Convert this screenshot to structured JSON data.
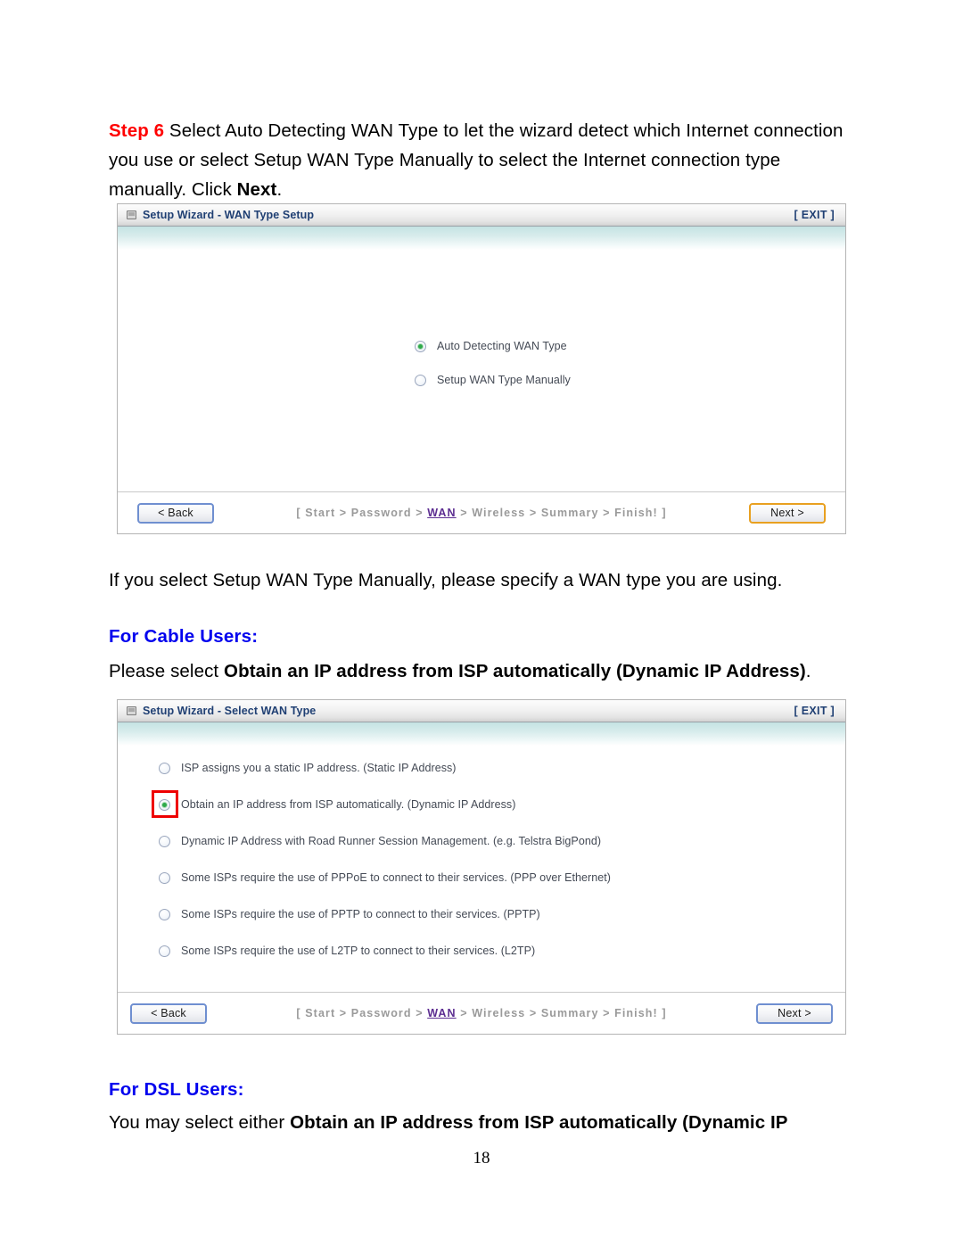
{
  "document": {
    "page_number": "18"
  },
  "step6": {
    "label": "Step 6",
    "text_part1": " Select Auto Detecting WAN Type to let the wizard detect which Internet connection you use or select Setup WAN Type Manually to select the Internet connection type manually. Click ",
    "bold_word": "Next",
    "text_part2": "."
  },
  "intro_paragraph": "If you select Setup WAN Type Manually, please specify a WAN type you are using.",
  "cable_section": {
    "heading": "For Cable Users:",
    "text_prefix": "Please select ",
    "text_bold": "Obtain an IP address from ISP automatically (Dynamic IP Address)",
    "text_suffix": "."
  },
  "dsl_section": {
    "heading": "For DSL Users:",
    "text_prefix": "You may select either ",
    "text_bold": "Obtain an IP address from ISP automatically (Dynamic IP"
  },
  "panel1": {
    "icon": "window-monitor-icon",
    "title": "Setup Wizard - WAN Type Setup",
    "exit_label": "[ EXIT ]",
    "options": [
      {
        "label": "Auto Detecting WAN Type",
        "selected": true
      },
      {
        "label": "Setup WAN Type Manually",
        "selected": false
      }
    ],
    "footer": {
      "back_label": "< Back",
      "next_label": "Next >",
      "next_focus_color": "#e8a020",
      "breadcrumb": {
        "open": "[ ",
        "items": [
          "Start",
          "Password",
          "WAN",
          "Wireless",
          "Summary",
          "Finish!"
        ],
        "active_item": "WAN",
        "separator": " > ",
        "close": " ]"
      }
    }
  },
  "panel2": {
    "icon": "window-monitor-icon",
    "title": "Setup Wizard - Select WAN Type",
    "exit_label": "[ EXIT ]",
    "options": [
      {
        "label": "ISP assigns you a static IP address. (Static IP Address)",
        "selected": false,
        "highlighted": false
      },
      {
        "label": "Obtain an IP address from ISP automatically. (Dynamic IP Address)",
        "selected": true,
        "highlighted": true
      },
      {
        "label": "Dynamic IP Address with Road Runner Session Management. (e.g. Telstra BigPond)",
        "selected": false,
        "highlighted": false
      },
      {
        "label": "Some ISPs require the use of PPPoE to connect to their services. (PPP over Ethernet)",
        "selected": false,
        "highlighted": false
      },
      {
        "label": "Some ISPs require the use of PPTP to connect to their services. (PPTP)",
        "selected": false,
        "highlighted": false
      },
      {
        "label": "Some ISPs require the use of L2TP to connect to their services. (L2TP)",
        "selected": false,
        "highlighted": false
      }
    ],
    "footer": {
      "back_label": "< Back",
      "next_label": "Next >",
      "next_focus_color": "#6f8fd0",
      "breadcrumb": {
        "open": "[ ",
        "items": [
          "Start",
          "Password",
          "WAN",
          "Wireless",
          "Summary",
          "Finish!"
        ],
        "active_item": "WAN",
        "separator": " > ",
        "close": " ]"
      }
    }
  },
  "colors": {
    "step_red": "#ff0000",
    "heading_blue": "#0000ee",
    "title_blue": "#1f3f73",
    "radio_green": "#2faa4a",
    "highlight_red": "#ee0000",
    "breadcrumb_gray": "#9a9a9a",
    "breadcrumb_active": "#5c2d91"
  }
}
